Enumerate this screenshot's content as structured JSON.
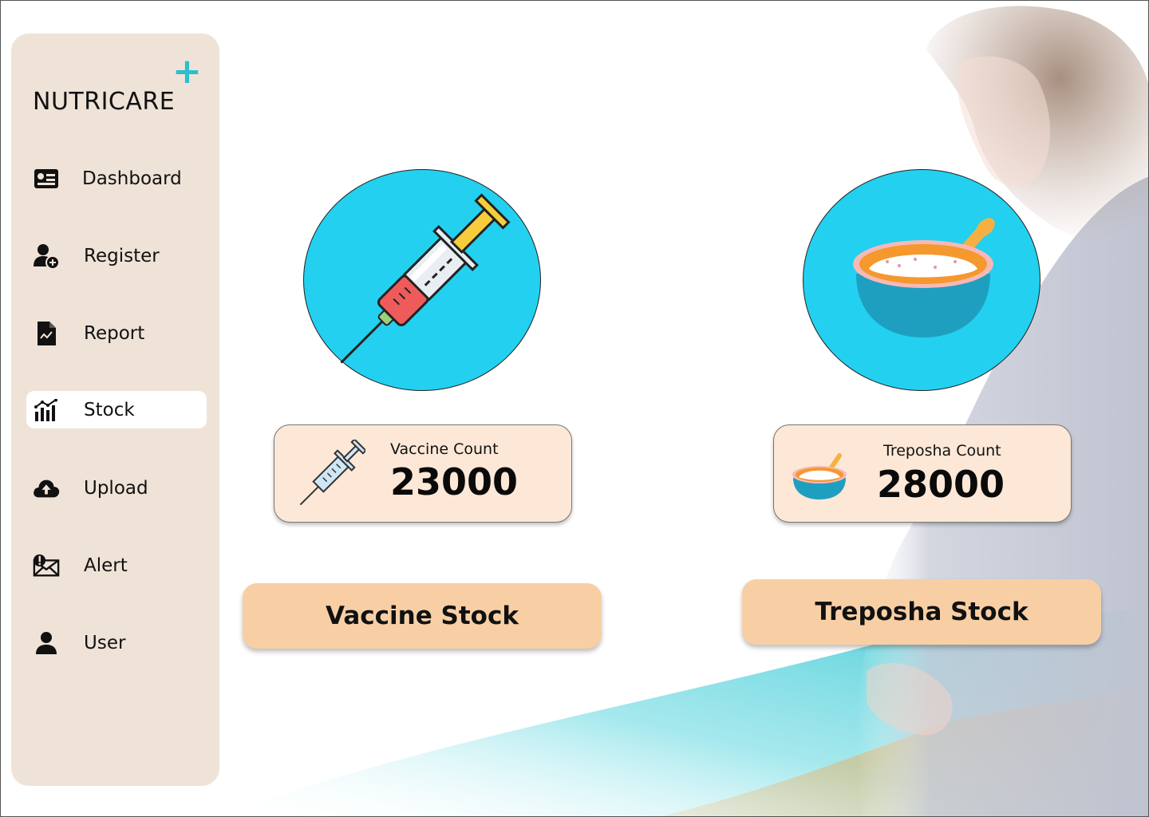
{
  "app": {
    "logo_text": "NUTRICARE",
    "logo_plus": "+"
  },
  "sidebar": {
    "items": [
      {
        "label": "Dashboard",
        "icon": "dashboard-icon",
        "active": false
      },
      {
        "label": "Register",
        "icon": "add-user-icon",
        "active": false
      },
      {
        "label": "Report",
        "icon": "report-icon",
        "active": false
      },
      {
        "label": "Stock",
        "icon": "stock-chart-icon",
        "active": true
      },
      {
        "label": "Upload",
        "icon": "cloud-upload-icon",
        "active": false
      },
      {
        "label": "Alert",
        "icon": "alert-mail-icon",
        "active": false
      },
      {
        "label": "User",
        "icon": "user-icon",
        "active": false
      }
    ]
  },
  "vaccine": {
    "count_label": "Vaccine Count",
    "count_value": "23000",
    "button_label": "Vaccine Stock",
    "icon": "syringe-icon"
  },
  "treposha": {
    "count_label": "Treposha Count",
    "count_value": "28000",
    "button_label": "Treposha Stock",
    "icon": "bowl-icon"
  },
  "colors": {
    "sidebar_bg": "#efe3d8",
    "circle_bg": "#23d0ef",
    "card_bg": "#fde8d7",
    "button_bg": "#f8cfa5",
    "accent": "#2bbfcf"
  }
}
